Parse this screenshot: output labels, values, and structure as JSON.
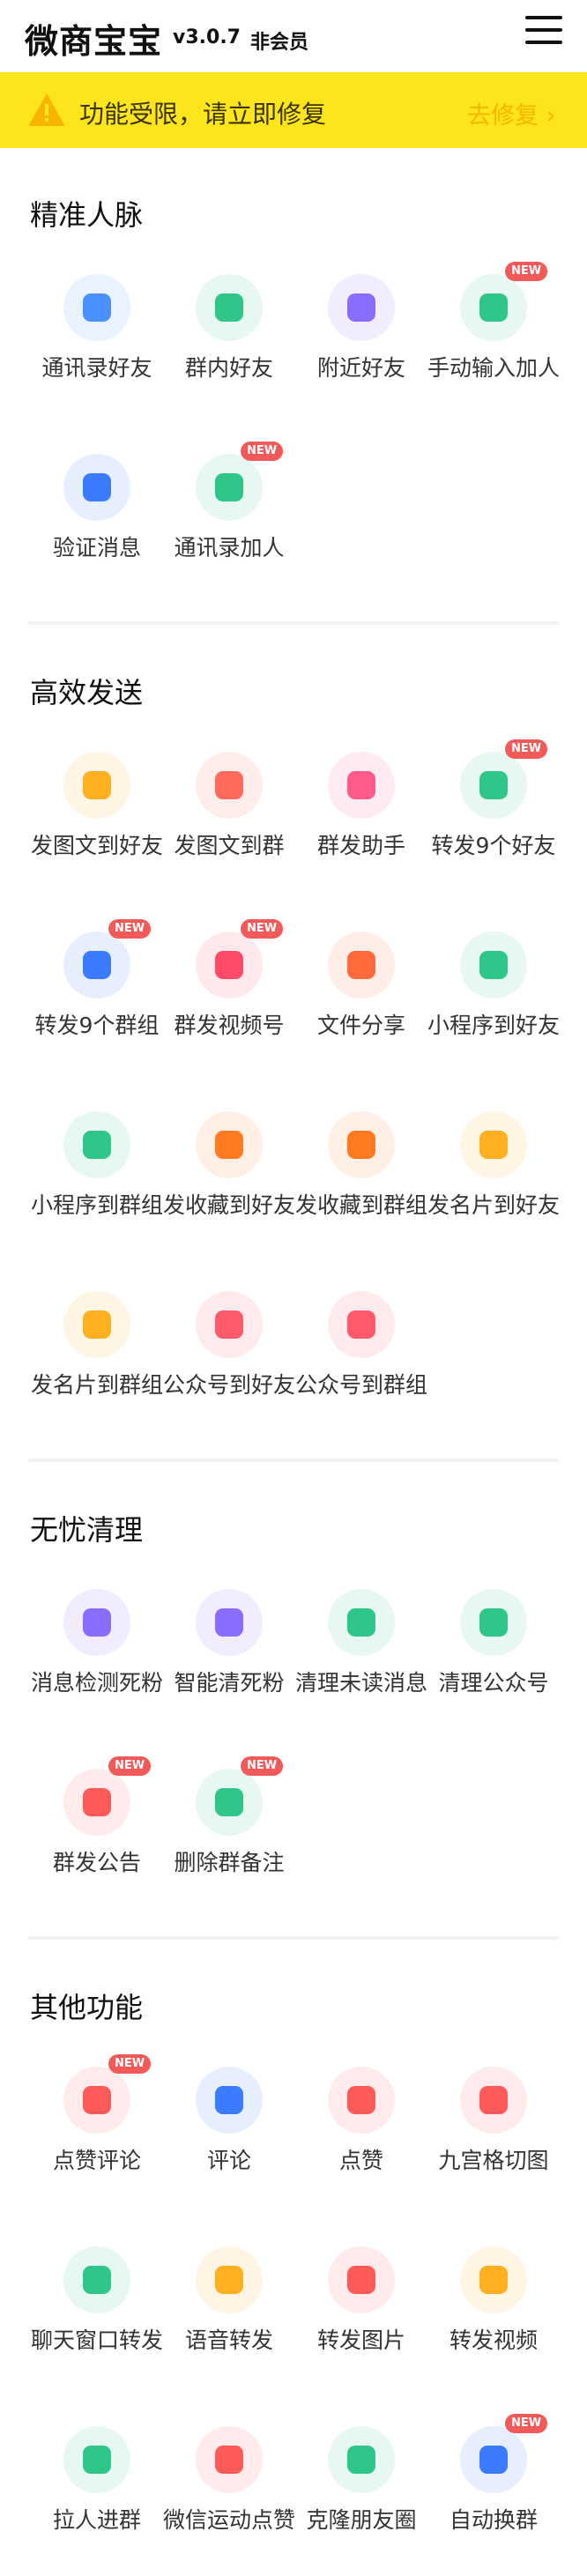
{
  "header": {
    "app_name": "微商宝宝",
    "version": "v3.0.7",
    "member_status": "非会员"
  },
  "warning": {
    "text": "功能受限，请立即修复",
    "action": "去修复 ›"
  },
  "badge_text": "NEW",
  "sections": [
    {
      "title": "精准人脉",
      "items": [
        {
          "label": "通讯录好友",
          "icon": "contact-book-icon",
          "color": "#4a90ff",
          "new": false
        },
        {
          "label": "群内好友",
          "icon": "group-add-icon",
          "color": "#2fc68a",
          "new": false
        },
        {
          "label": "附近好友",
          "icon": "location-pin-icon",
          "color": "#8a6cff",
          "new": false
        },
        {
          "label": "手动输入加人",
          "icon": "pencil-icon",
          "color": "#2fc68a",
          "new": true
        },
        {
          "label": "验证消息",
          "icon": "hi-message-icon",
          "color": "#3b7cff",
          "new": false
        },
        {
          "label": "通讯录加人",
          "icon": "add-contact-icon",
          "color": "#2fc68a",
          "new": true
        }
      ]
    },
    {
      "title": "高效发送",
      "items": [
        {
          "label": "发图文到好友",
          "icon": "image-text-icon",
          "color": "#ffb020",
          "new": false
        },
        {
          "label": "发图文到群",
          "icon": "image-text-group-icon",
          "color": "#ff6a5a",
          "new": false
        },
        {
          "label": "群发助手",
          "icon": "broadcast-helper-icon",
          "color": "#ff5a8a",
          "new": false
        },
        {
          "label": "转发9个好友",
          "icon": "forward-friend-icon",
          "color": "#2fc68a",
          "new": true
        },
        {
          "label": "转发9个群组",
          "icon": "forward-group-icon",
          "color": "#3b7cff",
          "new": true
        },
        {
          "label": "群发视频号",
          "icon": "video-channel-icon",
          "color": "#ff4a6a",
          "new": true
        },
        {
          "label": "文件分享",
          "icon": "folder-icon",
          "color": "#ff6a3a",
          "new": false
        },
        {
          "label": "小程序到好友",
          "icon": "mini-program-icon",
          "color": "#2fc68a",
          "new": false
        },
        {
          "label": "小程序到群组",
          "icon": "mini-program-group-icon",
          "color": "#2fc68a",
          "new": false
        },
        {
          "label": "发收藏到好友",
          "icon": "star-icon",
          "color": "#ff7a20",
          "new": false
        },
        {
          "label": "发收藏到群组",
          "icon": "star-badge-icon",
          "color": "#ff7a20",
          "new": false
        },
        {
          "label": "发名片到好友",
          "icon": "crown-card-icon",
          "color": "#ffb020",
          "new": false
        },
        {
          "label": "发名片到群组",
          "icon": "card-group-icon",
          "color": "#ffb020",
          "new": false
        },
        {
          "label": "公众号到好友",
          "icon": "official-account-icon",
          "color": "#ff5a6a",
          "new": false
        },
        {
          "label": "公众号到群组",
          "icon": "official-account-group-icon",
          "color": "#ff5a6a",
          "new": false
        }
      ]
    },
    {
      "title": "无忧清理",
      "items": [
        {
          "label": "消息检测死粉",
          "icon": "ghost-icon",
          "color": "#8a6cff",
          "new": false
        },
        {
          "label": "智能清死粉",
          "icon": "lightning-ghost-icon",
          "color": "#8a6cff",
          "new": false
        },
        {
          "label": "清理未读消息",
          "icon": "unread-message-icon",
          "color": "#2fc68a",
          "new": false
        },
        {
          "label": "清理公众号",
          "icon": "paper-plane-icon",
          "color": "#2fc68a",
          "new": false
        },
        {
          "label": "群发公告",
          "icon": "megaphone-icon",
          "color": "#ff5a5a",
          "new": true
        },
        {
          "label": "删除群备注",
          "icon": "trash-icon",
          "color": "#2fc68a",
          "new": true
        }
      ]
    },
    {
      "title": "其他功能",
      "items": [
        {
          "label": "点赞评论",
          "icon": "like-comment-icon",
          "color": "#ff5a5a",
          "new": true
        },
        {
          "label": "评论",
          "icon": "comment-icon",
          "color": "#3b7cff",
          "new": false
        },
        {
          "label": "点赞",
          "icon": "like-icon",
          "color": "#ff5a5a",
          "new": false
        },
        {
          "label": "九宫格切图",
          "icon": "grid-icon",
          "color": "#ff5a5a",
          "new": false
        },
        {
          "label": "聊天窗口转发",
          "icon": "chat-forward-icon",
          "color": "#2fc68a",
          "new": false
        },
        {
          "label": "语音转发",
          "icon": "voice-icon",
          "color": "#ffb020",
          "new": false
        },
        {
          "label": "转发图片",
          "icon": "image-forward-icon",
          "color": "#ff5a5a",
          "new": false
        },
        {
          "label": "转发视频",
          "icon": "video-forward-icon",
          "color": "#ffb020",
          "new": false
        },
        {
          "label": "拉人进群",
          "icon": "invite-group-icon",
          "color": "#2fc68a",
          "new": false
        },
        {
          "label": "微信运动点赞",
          "icon": "sport-like-icon",
          "color": "#ff5a5a",
          "new": false
        },
        {
          "label": "克隆朋友圈",
          "icon": "moments-clone-icon",
          "color": "#2fc68a",
          "new": false
        },
        {
          "label": "自动换群",
          "icon": "auto-switch-group-icon",
          "color": "#3b7cff",
          "new": true
        }
      ]
    }
  ]
}
